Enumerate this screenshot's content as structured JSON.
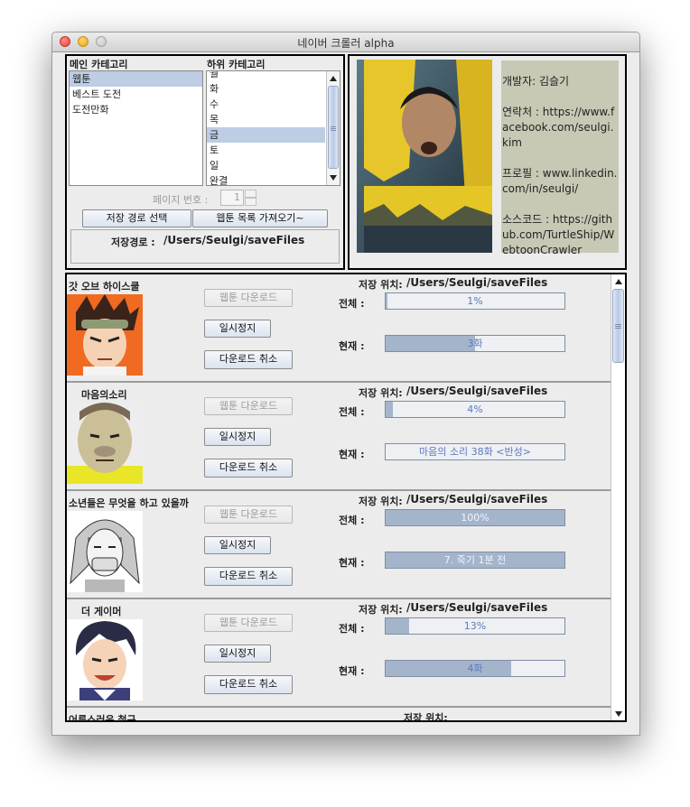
{
  "window": {
    "title": "네이버 크롤러 alpha"
  },
  "categories": {
    "main_label": "메인 카테고리",
    "sub_label": "하위 카테고리",
    "main_items": [
      "웹툰",
      "베스트 도전",
      "도전만화"
    ],
    "main_selected": 0,
    "sub_items": [
      "월",
      "화",
      "수",
      "목",
      "금",
      "토",
      "일",
      "완결"
    ],
    "sub_selected": 4
  },
  "page": {
    "label": "페이지 번호 :",
    "value": "1"
  },
  "buttons": {
    "choose_path": "저장 경로 선택",
    "fetch_list": "웹툰 목록 가져오기~"
  },
  "save_path": {
    "label": "저장경로 :",
    "value": "/Users/Seulgi/saveFiles"
  },
  "profile": {
    "lines": [
      "개발자: 김슬기",
      "연락처 : https://www.facebook.com/seulgi.kim",
      "프로필 : www.linkedin.com/in/seulgi/",
      "소스코드 : https://github.com/TurtleShip/WebtoonCrawler"
    ]
  },
  "download_panel": {
    "labels": {
      "save_location": "저장 위치:",
      "total": "전체 :",
      "current": "현재 :",
      "download_btn": "웹툰 다운로드",
      "pause_btn": "일시정지",
      "cancel_btn": "다운로드 취소"
    },
    "items": [
      {
        "name": "갓 오브 하이스쿨",
        "path": "/Users/Seulgi/saveFiles",
        "total_text": "1%",
        "total_fraction": 0.01,
        "current_text": "3화",
        "current_fraction": 0.5
      },
      {
        "name": "마음의소리",
        "path": "/Users/Seulgi/saveFiles",
        "total_text": "4%",
        "total_fraction": 0.04,
        "current_text": "마음의 소리 38화 <반성>",
        "current_fraction": 0
      },
      {
        "name": "소년들은 무엇을 하고 있을까",
        "path": "/Users/Seulgi/saveFiles",
        "total_text": "100%",
        "total_fraction": 1.0,
        "current_text": "7. 죽기 1분 전",
        "current_fraction": 1.0
      },
      {
        "name": "더 게이머",
        "path": "/Users/Seulgi/saveFiles",
        "total_text": "13%",
        "total_fraction": 0.13,
        "current_text": "4화",
        "current_fraction": 0.7
      },
      {
        "name": "어른스러운 철구"
      }
    ]
  }
}
